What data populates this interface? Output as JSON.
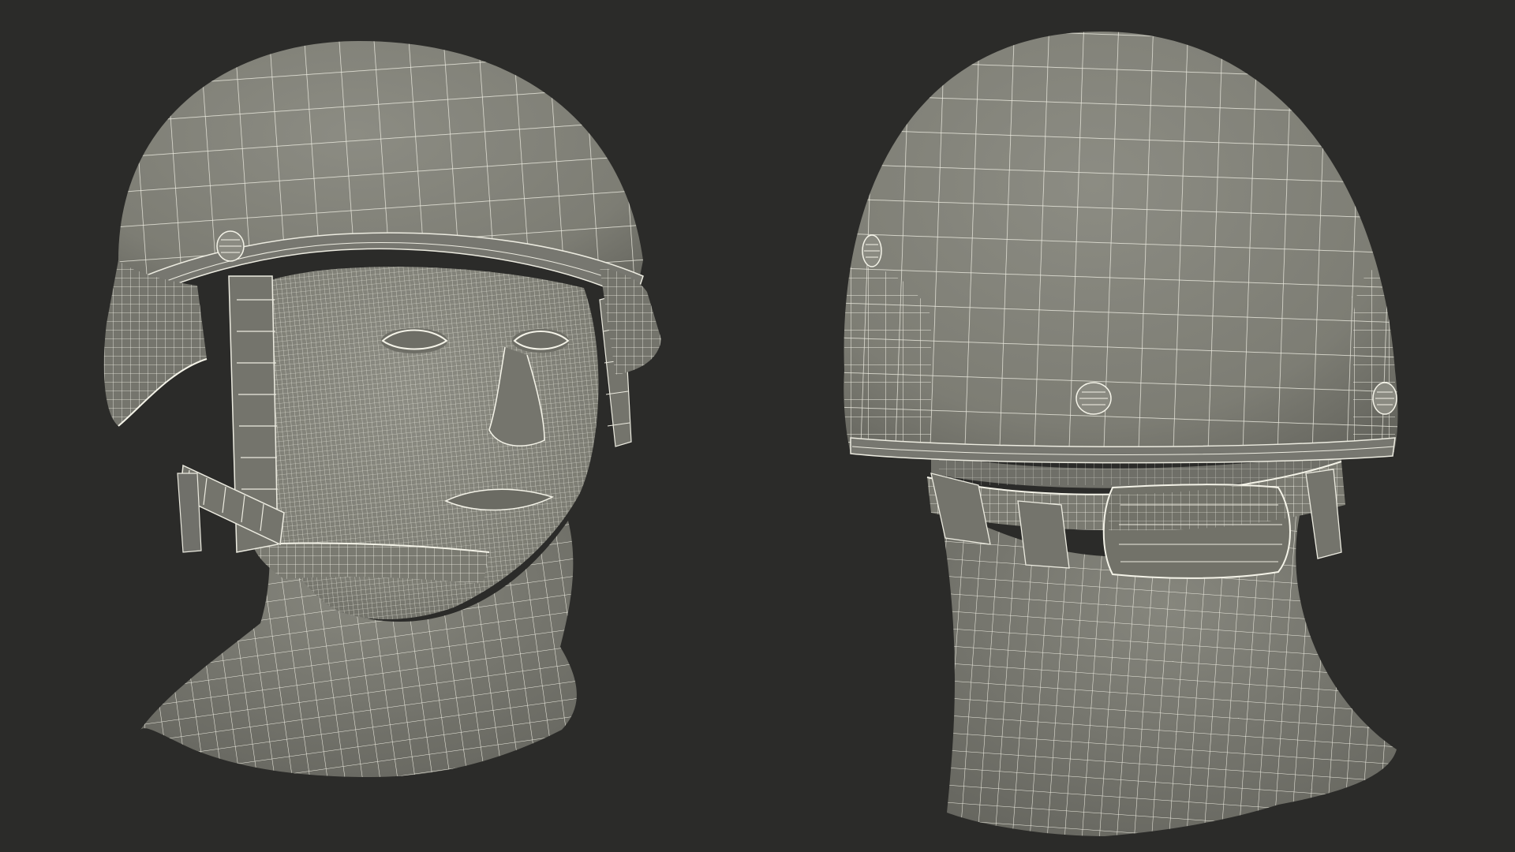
{
  "colors": {
    "background": "#2b2b29",
    "surface": "#7d7d74",
    "surface_dark": "#6a6a62",
    "surface_light": "#8c8c83",
    "wire": "#ecebe0",
    "wire_dense": "#f2f1e6"
  },
  "views": [
    {
      "view": "front-three-quarter"
    },
    {
      "view": "back"
    }
  ]
}
